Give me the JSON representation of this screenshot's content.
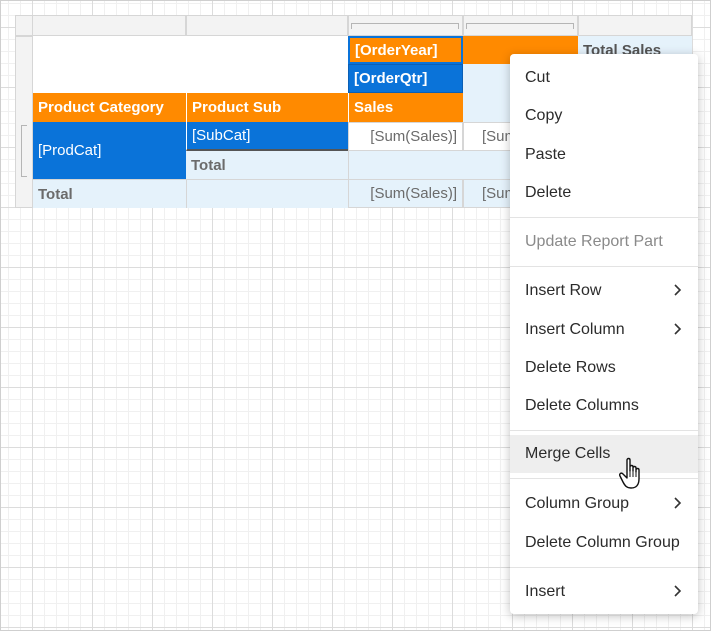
{
  "table": {
    "header_cells": {
      "order_year": "[OrderYear]",
      "total_sales": "Total Sales",
      "order_qtr": "[OrderQtr]",
      "product_category": "Product Category",
      "product_sub": "Product Sub",
      "sales": "Sales"
    },
    "body_cells": {
      "prodcat": "[ProdCat]",
      "subcat": "[SubCat]",
      "sum_sales_1": "[Sum(Sales)]",
      "sum_sales_2": "[Sum(Sales)]",
      "sub_total": "Total",
      "grand_total": "Total",
      "sum_sales_3": "[Sum(Sales)]",
      "sum_sales_4": "[Sum(Sales)]"
    }
  },
  "context_menu": {
    "items": [
      {
        "label": "Cut"
      },
      {
        "label": "Copy"
      },
      {
        "label": "Paste"
      },
      {
        "label": "Delete"
      },
      {
        "label": "Update Report Part",
        "disabled": true
      },
      {
        "label": "Insert Row",
        "submenu": true
      },
      {
        "label": "Insert Column",
        "submenu": true
      },
      {
        "label": "Delete Rows"
      },
      {
        "label": "Delete Columns"
      },
      {
        "label": "Merge Cells",
        "hovered": true
      },
      {
        "label": "Column Group",
        "submenu": true
      },
      {
        "label": "Delete Column Group"
      },
      {
        "label": "Insert",
        "submenu": true
      }
    ]
  },
  "colors": {
    "orange": "#ff8a00",
    "blue": "#0a73d9",
    "light_blue": "#e5f2fb"
  }
}
